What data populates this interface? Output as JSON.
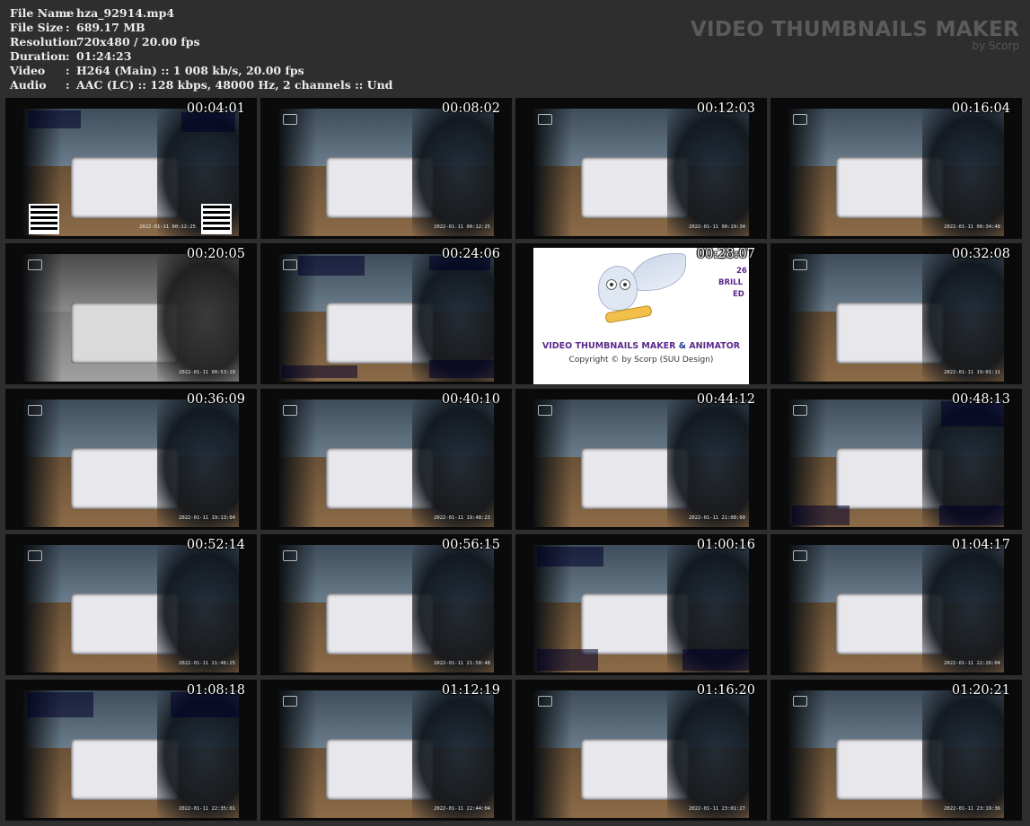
{
  "info": {
    "rows": [
      {
        "key": "File Name",
        "value": "hza_92914.mp4"
      },
      {
        "key": "File Size",
        "value": "689.17 MB"
      },
      {
        "key": "Resolution",
        "value": "720x480 / 20.00 fps"
      },
      {
        "key": "Duration",
        "value": "01:24:23"
      },
      {
        "key": "Video",
        "value": "H264 (Main) :: 1 008 kb/s, 20.00 fps"
      },
      {
        "key": "Audio",
        "value": "AAC (LC) :: 128 kbps, 48000 Hz, 2 channels :: Und"
      }
    ],
    "sep": ":"
  },
  "brand": {
    "title": "VIDEO THUMBNAILS MAKER",
    "subtitle": "by Scorp"
  },
  "thumbs": [
    {
      "time": "00:04:01",
      "stamp": "2022-01-11 00:12:25"
    },
    {
      "time": "00:08:02",
      "stamp": "2022-01-11 00:12:25"
    },
    {
      "time": "00:12:03",
      "stamp": "2022-01-11 00:19:34"
    },
    {
      "time": "00:16:04",
      "stamp": "2022-01-11 00:34:48"
    },
    {
      "time": "00:20:05",
      "stamp": "2022-01-11 00:53:19"
    },
    {
      "time": "00:24:06",
      "stamp": ""
    },
    {
      "time": "00:28:07",
      "stamp": ""
    },
    {
      "time": "00:32:08",
      "stamp": "2022-01-11 19:01:11"
    },
    {
      "time": "00:36:09",
      "stamp": "2022-01-11 19:13:04"
    },
    {
      "time": "00:40:10",
      "stamp": "2022-01-11 19:48:23"
    },
    {
      "time": "00:44:12",
      "stamp": "2022-01-11 21:08:09"
    },
    {
      "time": "00:48:13",
      "stamp": ""
    },
    {
      "time": "00:52:14",
      "stamp": "2022-01-11 21:46:25"
    },
    {
      "time": "00:56:15",
      "stamp": "2022-01-11 21:58:48"
    },
    {
      "time": "01:00:16",
      "stamp": ""
    },
    {
      "time": "01:04:17",
      "stamp": "2022-01-11 22:26:04"
    },
    {
      "time": "01:08:18",
      "stamp": "2022-01-11 22:35:01"
    },
    {
      "time": "01:12:19",
      "stamp": "2022-01-11 22:44:04"
    },
    {
      "time": "01:16:20",
      "stamp": "2022-01-11 23:01:27"
    },
    {
      "time": "01:20:21",
      "stamp": "2022-01-11 23:19:36"
    }
  ],
  "owl_card": {
    "title_a": "VIDEO THUMBNAILS MAKER",
    "title_amp": " & ",
    "title_b": "ANIMATOR",
    "copyright": "Copyright © by Scorp (SUU Design)",
    "side_1": "26",
    "side_2": "BRILL",
    "side_3": "ED"
  }
}
